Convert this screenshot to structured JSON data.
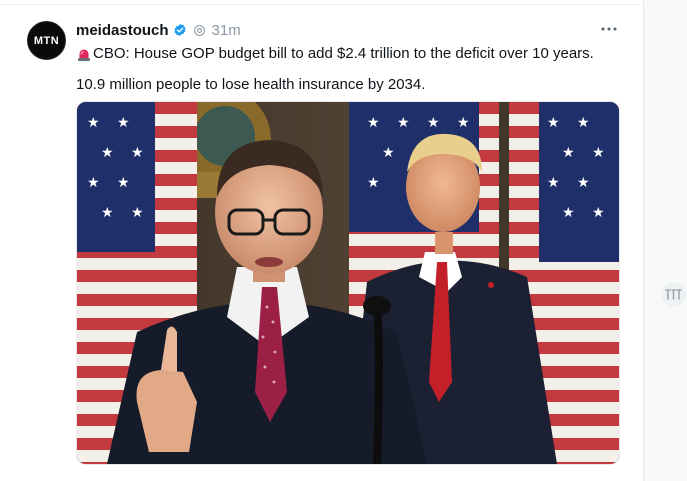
{
  "post": {
    "username": "meidastouch",
    "time": "31m",
    "avatar_text": "MTN",
    "text_line1": "CBO: House GOP budget bill to add $2.4 trillion to the deficit over 10 years.",
    "text_line2": "10.9 million people to lose health insurance by 2034."
  },
  "icons": {
    "verified": "verified-badge-icon",
    "affiliate": "affiliate-icon",
    "more": "more-icon",
    "siren": "siren-emoji-icon",
    "side": "translate-icon"
  },
  "colors": {
    "verified": "#1d9bf0",
    "muted": "#8b98a5",
    "siren": "#e0245e"
  }
}
